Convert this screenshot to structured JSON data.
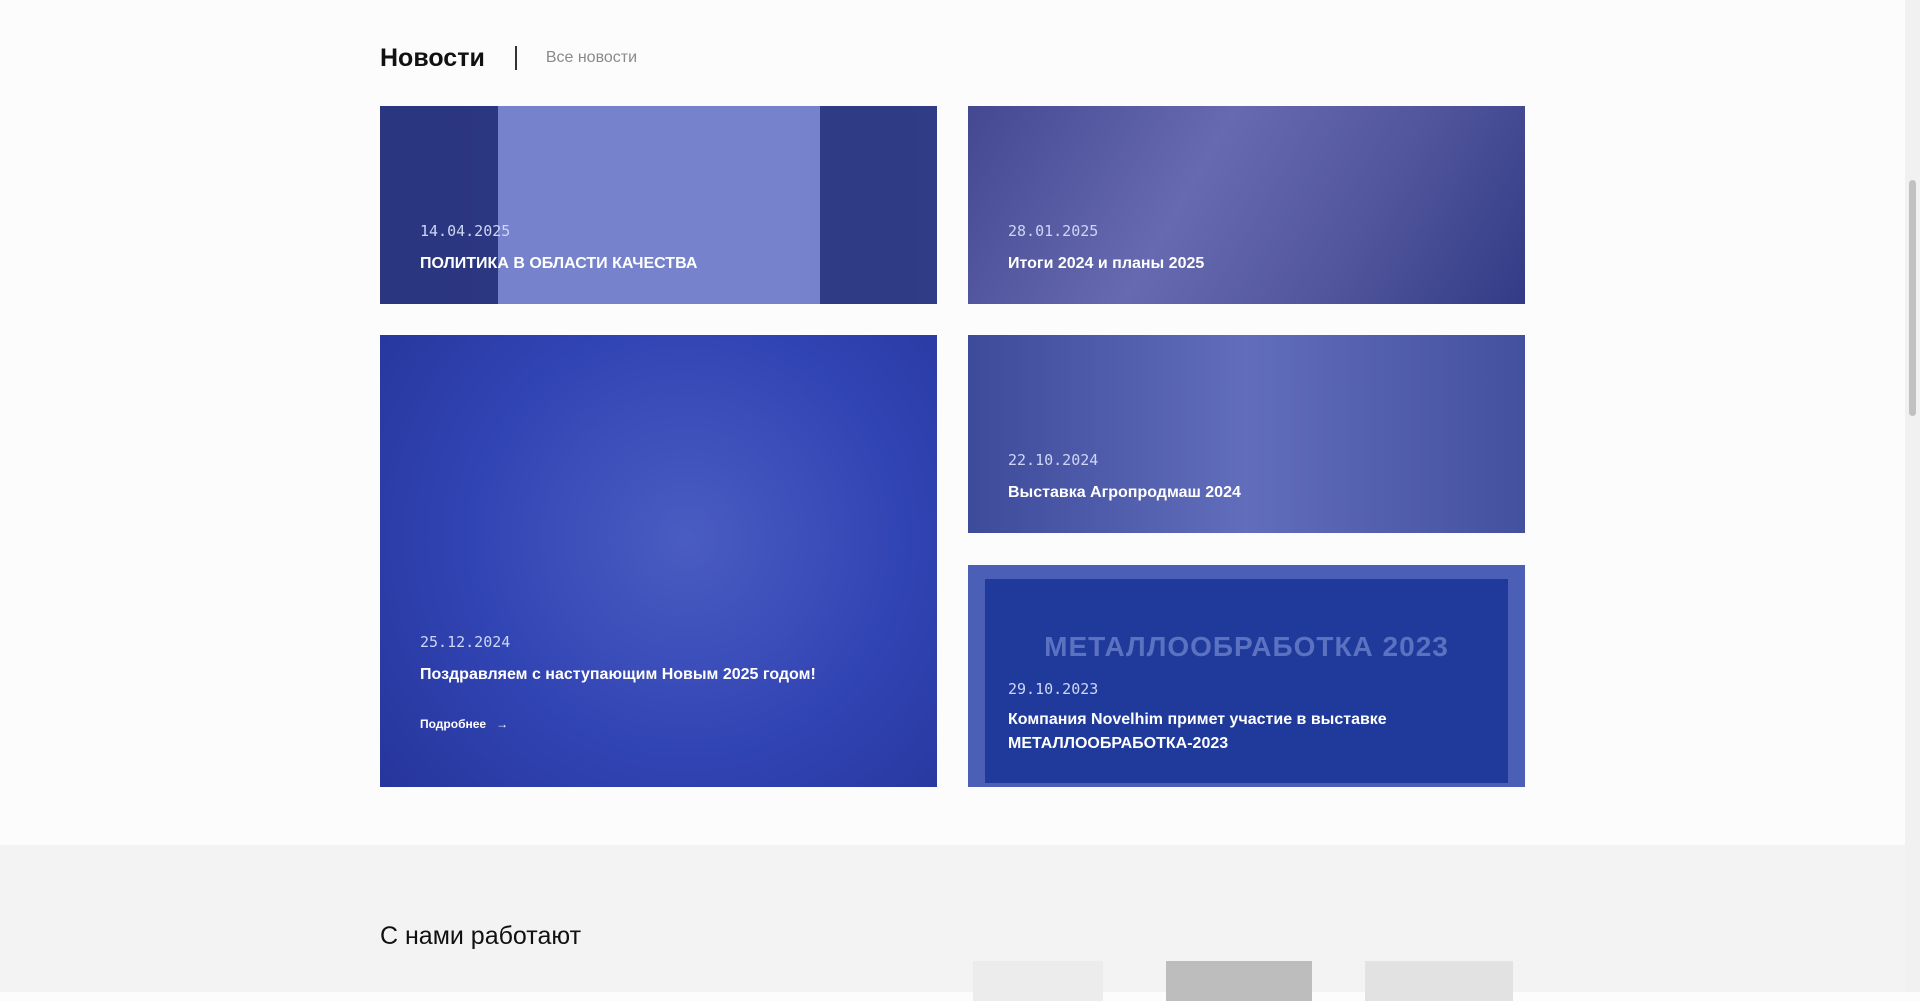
{
  "news": {
    "title": "Новости",
    "all_link": "Все новости",
    "cards": [
      {
        "date": "14.04.2025",
        "title": "ПОЛИТИКА В ОБЛАСТИ КАЧЕСТВА"
      },
      {
        "date": "28.01.2025",
        "title": "Итоги 2024 и планы 2025"
      },
      {
        "date": "25.12.2024",
        "title": "Поздравляем с наступающим Новым 2025 годом!",
        "more": "Подробнее",
        "more_arrow": "→"
      },
      {
        "date": "22.10.2024",
        "title": "Выставка Агропродмаш 2024"
      },
      {
        "date": "29.10.2023",
        "title": "Компания Novelhim примет участие в выставке МЕТАЛЛООБРАБОТКА-2023",
        "image_text": "МЕТАЛЛООБРАБОТКА 2023"
      }
    ]
  },
  "partners": {
    "title": "С нами работают"
  },
  "colors": {
    "overlay": "#2c3eb4",
    "page_bg": "#fcfcfc",
    "section_bg": "#f3f3f3"
  }
}
